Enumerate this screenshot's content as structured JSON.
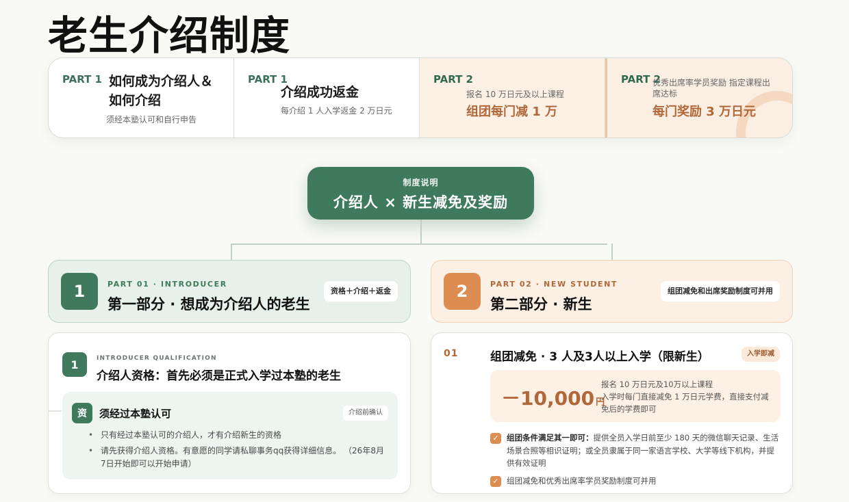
{
  "page": {
    "title": "老生介绍制度"
  },
  "summary": [
    {
      "part": "PART 1",
      "main": "如何成为介绍人＆\n如何介绍",
      "sub": "须经本塾认可和自行申告"
    },
    {
      "part": "PART 1",
      "main": "介绍成功返金",
      "sub": "每介绍 1 人入学返金 2 万日元"
    },
    {
      "part": "PART 2",
      "sub": "报名 10 万日元及以上课程",
      "big": "组团每门减 1 万"
    },
    {
      "part": "PART 2",
      "sub": "优秀出席率学员奖励 指定课程出席达标",
      "big": "每门奖励 3 万日元"
    }
  ],
  "banner": {
    "sub": "制度说明",
    "main": "介绍人 × 新生减免及奖励"
  },
  "section1": {
    "num": "1",
    "kicker": "PART 01 · INTRODUCER",
    "title": "第一部分 · 想成为介绍人的老生",
    "pill": "资格＋介绍＋返金",
    "card": {
      "num": "1",
      "kicker": "INTRODUCER QUALIFICATION",
      "title": "介绍人资格：首先必须是正式入学过本塾的老生",
      "panel": {
        "badge": "资",
        "title": "须经过本塾认可",
        "tag": "介绍前确认",
        "bullets": [
          "只有经过本塾认可的介绍人，才有介绍新生的资格",
          "请先获得介绍人资格。有意愿的同学请私聊事务qq获得详细信息。 （26年8月7日开始即可以开始申请）"
        ]
      }
    }
  },
  "section2": {
    "num": "2",
    "kicker": "PART 02 · NEW STUDENT",
    "title": "第二部分 · 新生",
    "pill": "组团减免和出席奖励制度可并用",
    "card": {
      "num": "01",
      "title": "组团减免 · 3 人及3人以上入学（限新生）",
      "pill": "入学即减",
      "price": "－10,000",
      "price_unit": "円",
      "price_desc": "报名 10 万日元及10万以上课程\n入学时每门直接减免 1 万日元学费，直接支付减免后的学费即可",
      "checks": [
        {
          "lead": "组团条件满足其一即可：",
          "text": "提供全员入学日前至少 180 天的微信聊天记录、生活场景合照等相识证明；或全员隶属于同一家语言学校、大学等线下机构，并提供有效证明"
        },
        {
          "lead": "",
          "text": "组团减免和优秀出席率学员奖励制度可并用"
        }
      ],
      "check_mark": "✓"
    }
  },
  "colors": {
    "green": "#3f7a5c",
    "orange": "#dd8c52",
    "accent_text": "#b0683a"
  }
}
